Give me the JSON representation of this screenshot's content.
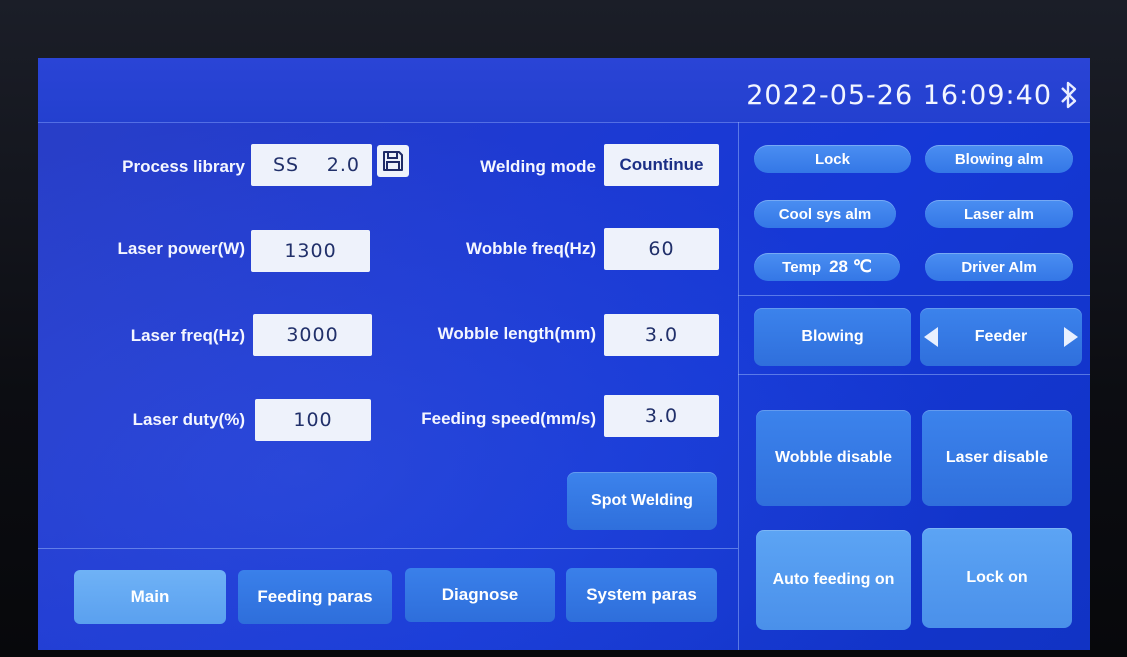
{
  "header": {
    "datetime": "2022-05-26 16:09:40"
  },
  "params": {
    "process_library": {
      "label": "Process library",
      "material": "SS",
      "value": "2.0"
    },
    "welding_mode": {
      "label": "Welding mode",
      "value": "Countinue"
    },
    "laser_power": {
      "label": "Laser power(W)",
      "value": "1300"
    },
    "wobble_freq": {
      "label": "Wobble freq(Hz)",
      "value": "60"
    },
    "laser_freq": {
      "label": "Laser freq(Hz)",
      "value": "3000"
    },
    "wobble_length": {
      "label": "Wobble length(mm)",
      "value": "3.0"
    },
    "laser_duty": {
      "label": "Laser duty(%)",
      "value": "100"
    },
    "feeding_speed": {
      "label": "Feeding speed(mm/s)",
      "value": "3.0"
    }
  },
  "buttons": {
    "spot_welding": "Spot Welding"
  },
  "status": {
    "lock": "Lock",
    "blowing_alm": "Blowing alm",
    "cool_sys_alm": "Cool sys alm",
    "laser_alm": "Laser alm",
    "temp_label": "Temp",
    "temp_value": "28 ℃",
    "driver_alm": "Driver Alm"
  },
  "controls": {
    "blowing": "Blowing",
    "feeder": "Feeder",
    "wobble_disable": "Wobble disable",
    "laser_disable": "Laser disable",
    "auto_feeding_on": "Auto feeding on",
    "lock_on": "Lock on"
  },
  "nav": {
    "main": "Main",
    "feeding_paras": "Feeding paras",
    "diagnose": "Diagnose",
    "system_paras": "System paras"
  },
  "colors": {
    "screen_bg": "#1e3ad2",
    "pill": "#3477e6",
    "field_bg": "#eef2fb",
    "active_tab": "#6fb2f6"
  },
  "icons": {
    "save": "floppy-disk-icon",
    "bluetooth": "bluetooth-icon",
    "feeder_prev": "triangle-left-icon",
    "feeder_next": "triangle-right-icon"
  }
}
